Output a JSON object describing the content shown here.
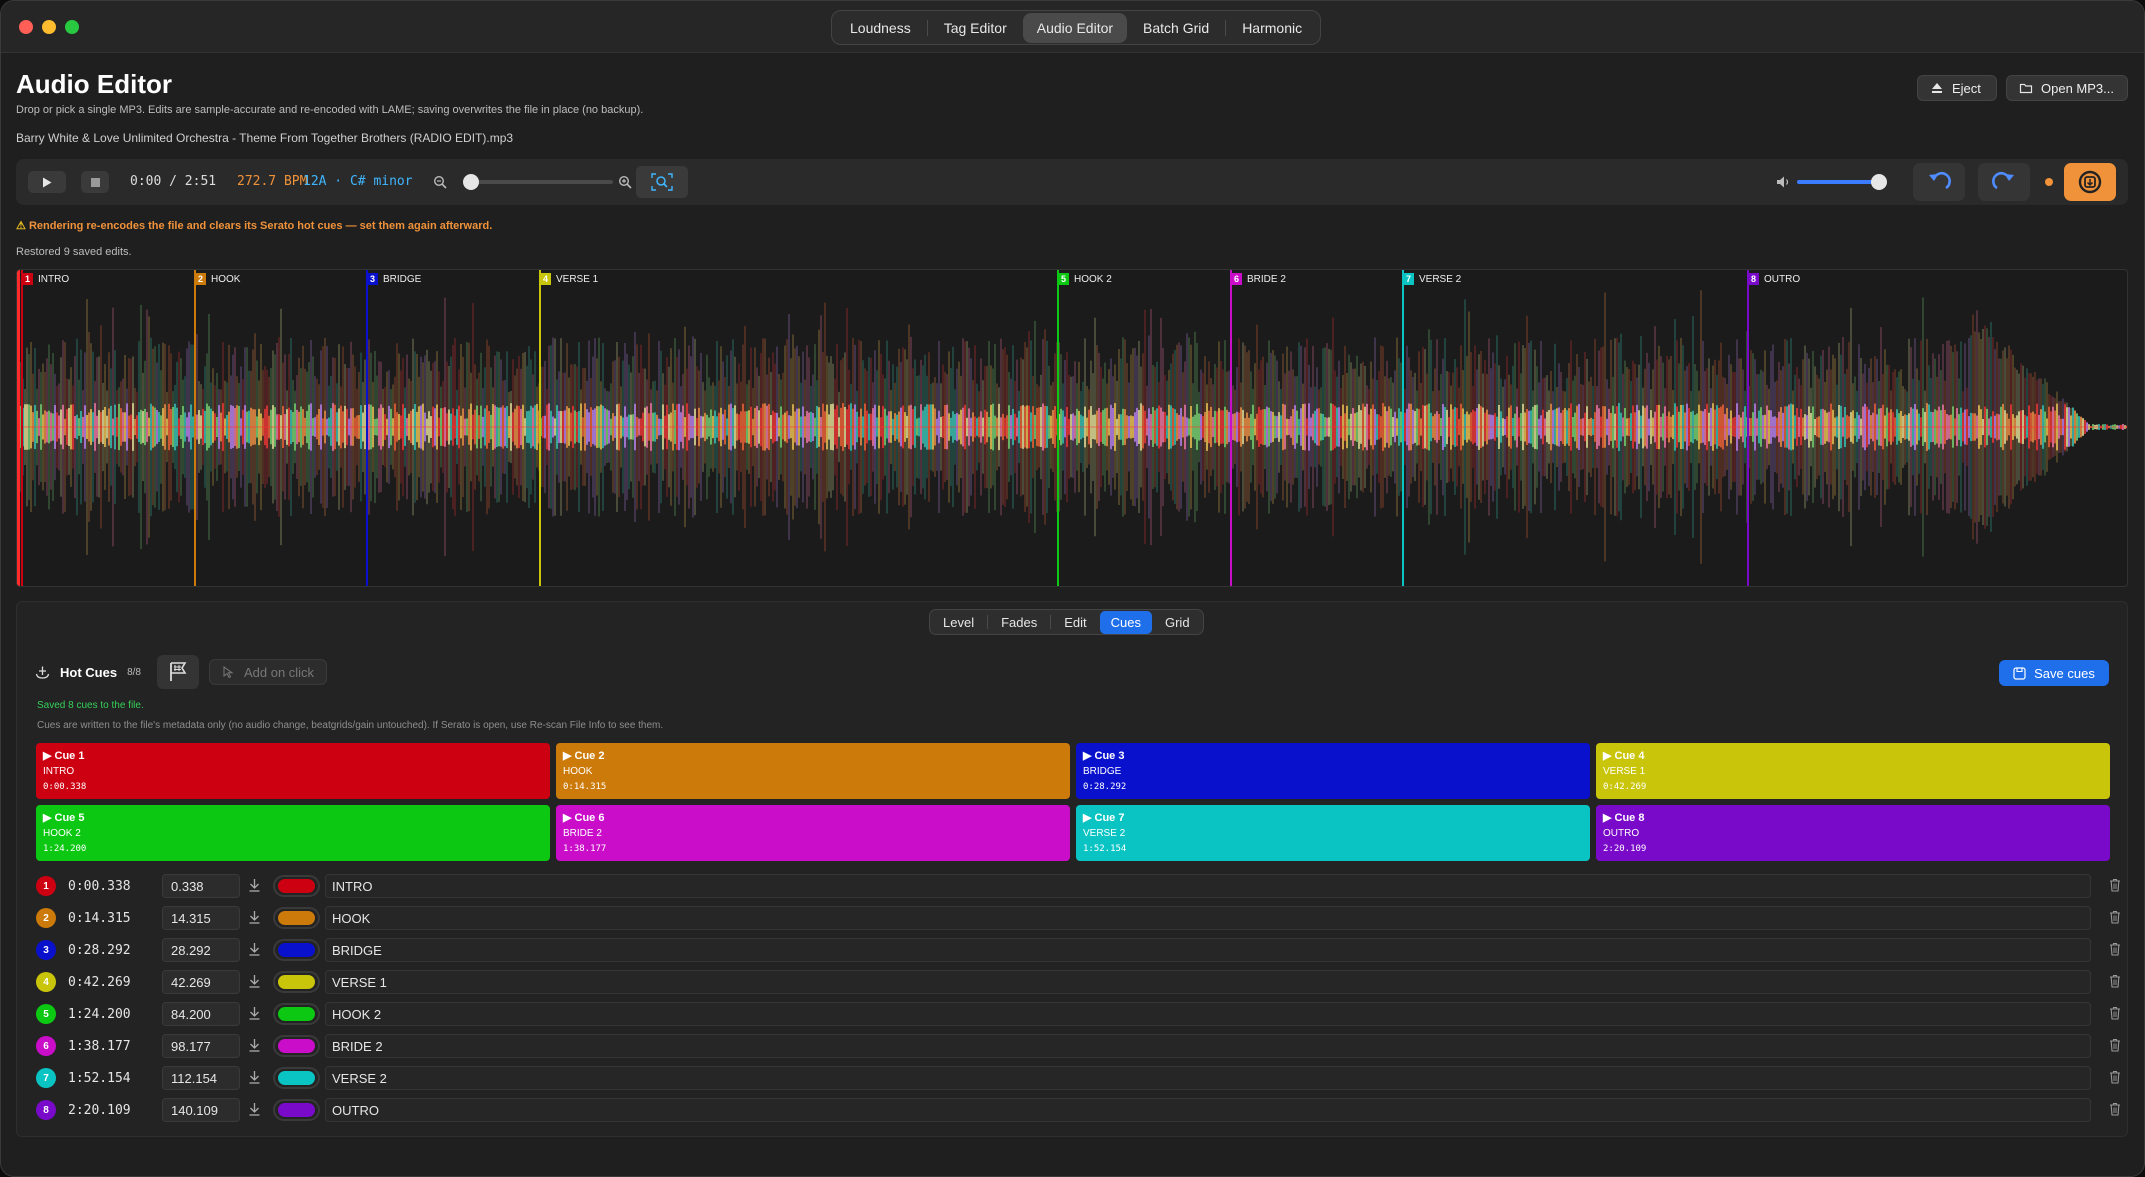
{
  "top_tabs": [
    "Loudness",
    "Tag Editor",
    "Audio Editor",
    "Batch Grid",
    "Harmonic"
  ],
  "header": {
    "title": "Audio Editor",
    "subtitle": "Drop or pick a single MP3. Edits are sample-accurate and re-encoded with LAME; saving overwrites the file in place (no backup).",
    "filename": "Barry White & Love Unlimited Orchestra - Theme From Together Brothers (RADIO EDIT).mp3",
    "eject_label": "Eject",
    "open_label": "Open MP3..."
  },
  "transport": {
    "timecode": "0:00 / 2:51",
    "bpm": "272.7 BPM",
    "key": "12A · C# minor",
    "zoom_level": 0.02,
    "volume_level": 0.92
  },
  "warning": "Rendering re-encodes the file and clears its Serato hot cues — set them again afterward.",
  "restored": "Restored 9 saved edits.",
  "panel_tabs": [
    "Level",
    "Fades",
    "Edit",
    "Cues",
    "Grid"
  ],
  "hot_cues": {
    "title": "Hot Cues",
    "count": "8/8",
    "add_on_click": "Add on click",
    "save_label": "Save cues",
    "saved_msg": "Saved 8 cues to the file.",
    "note": "Cues are written to the file's metadata only (no audio change, beatgrids/gain untouched). If Serato is open, use Re-scan File Info to see them."
  },
  "track_seconds": 171,
  "cues": [
    {
      "num": "1",
      "name": "Cue 1",
      "label": "INTRO",
      "time": "0:00.338",
      "seconds": "0.338",
      "color": "#cc0011"
    },
    {
      "num": "2",
      "name": "Cue 2",
      "label": "HOOK",
      "time": "0:14.315",
      "seconds": "14.315",
      "color": "#cc7a0a"
    },
    {
      "num": "3",
      "name": "Cue 3",
      "label": "BRIDGE",
      "time": "0:28.292",
      "seconds": "28.292",
      "color": "#0a11cc"
    },
    {
      "num": "4",
      "name": "Cue 4",
      "label": "VERSE 1",
      "time": "0:42.269",
      "seconds": "42.269",
      "color": "#c9c50a"
    },
    {
      "num": "5",
      "name": "Cue 5",
      "label": "HOOK 2",
      "time": "1:24.200",
      "seconds": "84.200",
      "color": "#0dc812"
    },
    {
      "num": "6",
      "name": "Cue 6",
      "label": "BRIDE 2",
      "time": "1:38.177",
      "seconds": "98.177",
      "color": "#c90dc9"
    },
    {
      "num": "7",
      "name": "Cue 7",
      "label": "VERSE 2",
      "time": "1:52.154",
      "seconds": "112.154",
      "color": "#0ac4c4"
    },
    {
      "num": "8",
      "name": "Cue 8",
      "label": "OUTRO",
      "time": "2:20.109",
      "seconds": "140.109",
      "color": "#7a0ac9"
    }
  ],
  "icons": {
    "play": "play-icon",
    "stop": "stop-icon",
    "zoom_out": "zoom-out-icon",
    "zoom_in": "zoom-in-icon",
    "zoom_fit": "zoom-fit-icon",
    "volume": "volume-icon",
    "undo": "undo-icon",
    "redo": "redo-icon",
    "render": "render-icon",
    "eject": "eject-icon",
    "folder": "folder-icon",
    "anchor": "anchor-icon",
    "flag": "flag-icon",
    "save": "save-icon",
    "download": "download-icon",
    "trash": "trash-icon"
  },
  "colors": {
    "accent": "#1f6feb",
    "orange": "#f0923a",
    "warning": "#f0923a",
    "success": "#35d05a",
    "key": "#3fb6ff"
  }
}
